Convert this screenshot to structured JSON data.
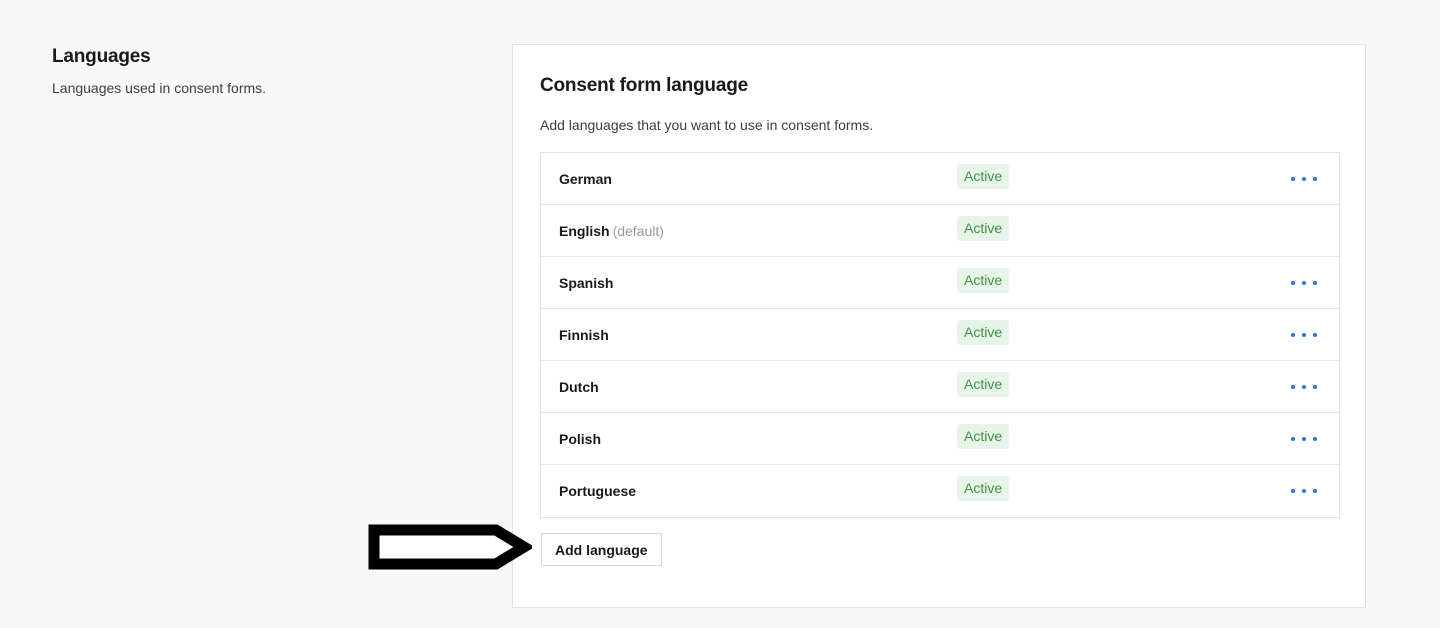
{
  "section": {
    "title": "Languages",
    "subtitle": "Languages used in consent forms."
  },
  "card": {
    "title": "Consent form language",
    "description": "Add languages that you want to use in consent forms.",
    "add_button_label": "Add language",
    "languages": [
      {
        "name": "German",
        "suffix": "",
        "status": "Active",
        "has_menu": true
      },
      {
        "name": "English",
        "suffix": "(default)",
        "status": "Active",
        "has_menu": false
      },
      {
        "name": "Spanish",
        "suffix": "",
        "status": "Active",
        "has_menu": true
      },
      {
        "name": "Finnish",
        "suffix": "",
        "status": "Active",
        "has_menu": true
      },
      {
        "name": "Dutch",
        "suffix": "",
        "status": "Active",
        "has_menu": true
      },
      {
        "name": "Polish",
        "suffix": "",
        "status": "Active",
        "has_menu": true
      },
      {
        "name": "Portuguese",
        "suffix": "",
        "status": "Active",
        "has_menu": true
      }
    ]
  },
  "annotation": {
    "shape": "right-arrow-outline",
    "color": "#000000"
  },
  "colors": {
    "page_background": "#f8f8f8",
    "card_background": "#ffffff",
    "border": "#e3e3e3",
    "badge_background": "#e7f5e8",
    "badge_text": "#3f8f43",
    "menu_dots": "#2a70e8",
    "text_primary": "#1a1a1a",
    "text_muted": "#9a9a9a"
  }
}
